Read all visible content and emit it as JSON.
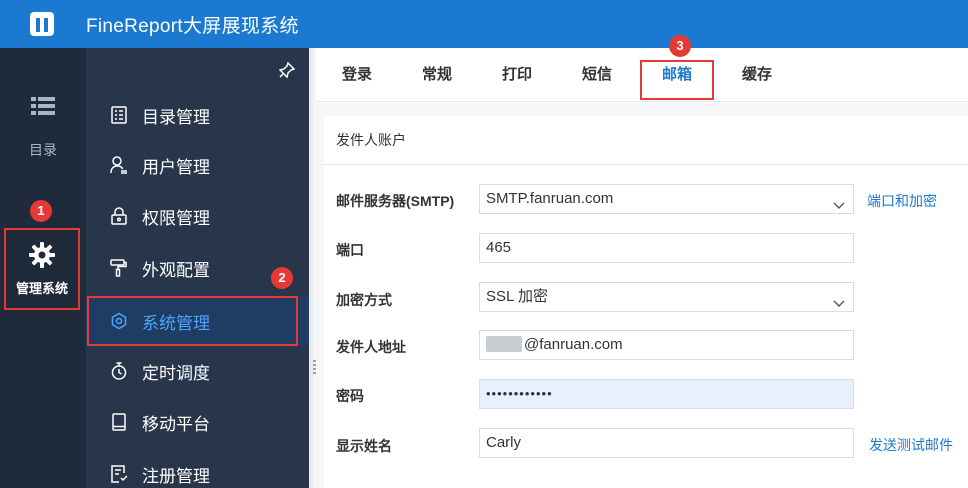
{
  "header": {
    "title": "FineReport大屏展现系统"
  },
  "rail": {
    "items": [
      {
        "label": "目录",
        "icon": "list-icon"
      },
      {
        "label": "管理系统",
        "icon": "gear-icon"
      }
    ]
  },
  "sidebar": {
    "items": [
      {
        "label": "目录管理",
        "icon": "directory-icon"
      },
      {
        "label": "用户管理",
        "icon": "user-icon"
      },
      {
        "label": "权限管理",
        "icon": "lock-icon"
      },
      {
        "label": "外观配置",
        "icon": "paint-roller-icon"
      },
      {
        "label": "系统管理",
        "icon": "settings-icon",
        "active": true
      },
      {
        "label": "定时调度",
        "icon": "timer-icon"
      },
      {
        "label": "移动平台",
        "icon": "tablet-icon"
      },
      {
        "label": "注册管理",
        "icon": "register-icon"
      }
    ]
  },
  "tabs": [
    {
      "label": "登录"
    },
    {
      "label": "常规"
    },
    {
      "label": "打印"
    },
    {
      "label": "短信"
    },
    {
      "label": "邮箱",
      "active": true
    },
    {
      "label": "缓存"
    }
  ],
  "section": {
    "title": "发件人账户"
  },
  "form": {
    "smtp": {
      "label": "邮件服务器(SMTP)",
      "value": "SMTP.fanruan.com",
      "link": "端口和加密"
    },
    "port": {
      "label": "端口",
      "value": "465"
    },
    "encryption": {
      "label": "加密方式",
      "value": "SSL 加密"
    },
    "sender": {
      "label": "发件人地址",
      "value": "@fanruan.com"
    },
    "password": {
      "label": "密码",
      "value": "••••••••••••"
    },
    "display_name": {
      "label": "显示姓名",
      "value": "Carly",
      "link": "发送测试邮件"
    }
  },
  "badges": {
    "one": "1",
    "two": "2",
    "three": "3"
  },
  "colors": {
    "brand": "#1c79d2",
    "highlight": "#e53935",
    "sidebar": "#27364b",
    "rail": "#1f2a3a"
  }
}
